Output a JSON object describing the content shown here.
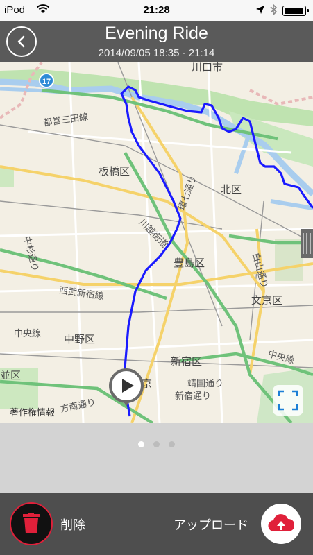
{
  "status_bar": {
    "carrier": "iPod",
    "time": "21:28"
  },
  "header": {
    "title": "Evening Ride",
    "date_range": "2014/09/05 18:35 - 21:14"
  },
  "map": {
    "route_shield": "17",
    "labels": {
      "kawaguchi": "川口市",
      "toei_mita": "都営三田線",
      "itabashi": "板橋区",
      "kannana": "環七通り",
      "kita": "北区",
      "kawagoe": "川越街道",
      "nakasugi": "中杉通り",
      "toshima": "豊島区",
      "hakusan": "白山通り",
      "seibu_shinjuku": "西武新宿線",
      "bunkyo": "文京区",
      "chuo_sen": "中央線",
      "nakano": "中野区",
      "shinjuku": "新宿区",
      "chuo_sen_right": "中央線",
      "namiku": "並区",
      "tokyo": "京",
      "yasukuni": "靖国通り",
      "houhan": "方南通り",
      "shinjuku_dori": "新宿通り",
      "copyright": "著作権情報"
    }
  },
  "pager": {
    "pages": 3,
    "active_page": 1
  },
  "footer": {
    "delete_label": "削除",
    "upload_label": "アップロード"
  },
  "colors": {
    "route": "#1a1aff",
    "delete_ring": "#e0203a",
    "upload_icon": "#e0203a",
    "header_bg": "#5a5a5a"
  },
  "icons": {
    "back": "chevron-left-icon",
    "wifi": "wifi-icon",
    "location": "location-arrow-icon",
    "bluetooth": "bluetooth-icon",
    "battery": "battery-icon",
    "play": "play-icon",
    "expand": "expand-map-icon",
    "delete": "trash-icon",
    "upload": "cloud-upload-icon"
  }
}
